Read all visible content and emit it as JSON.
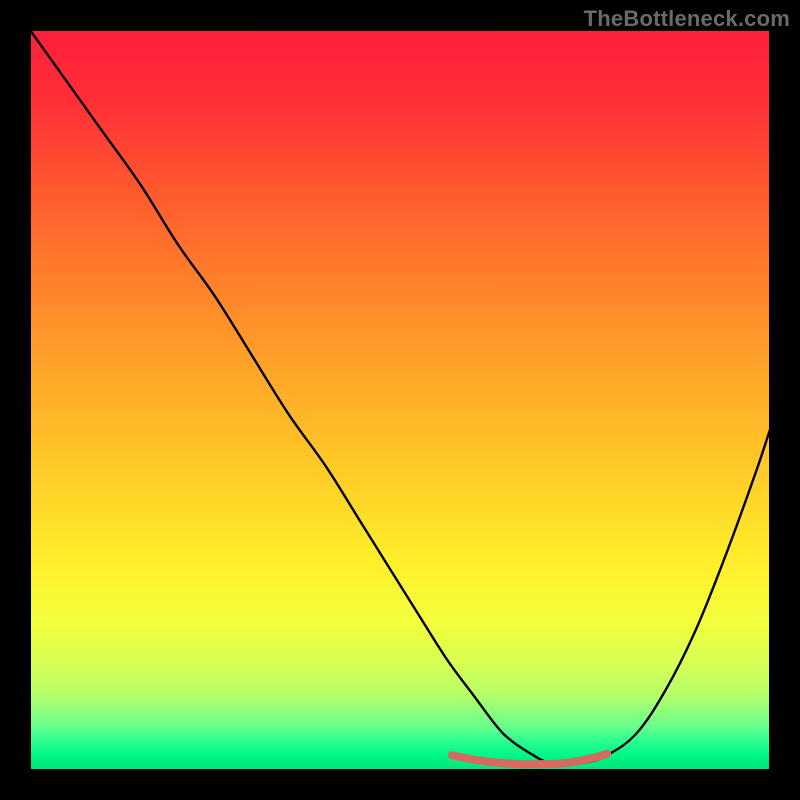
{
  "watermark": {
    "text": "TheBottleneck.com"
  },
  "colors": {
    "black": "#000000",
    "curve_stroke": "#000000",
    "marker_stroke": "#d76a5f",
    "gradient_stops": [
      {
        "offset": 0.0,
        "color": "#ff1f3a"
      },
      {
        "offset": 0.1,
        "color": "#ff3037"
      },
      {
        "offset": 0.22,
        "color": "#ff5a2e"
      },
      {
        "offset": 0.4,
        "color": "#ff932a"
      },
      {
        "offset": 0.58,
        "color": "#ffc727"
      },
      {
        "offset": 0.72,
        "color": "#ffef2a"
      },
      {
        "offset": 0.8,
        "color": "#f3ff3d"
      },
      {
        "offset": 0.86,
        "color": "#d5ff55"
      },
      {
        "offset": 0.9,
        "color": "#b3ff6a"
      },
      {
        "offset": 0.92,
        "color": "#8fff7c"
      },
      {
        "offset": 0.94,
        "color": "#6bff8a"
      },
      {
        "offset": 0.96,
        "color": "#2eff92"
      },
      {
        "offset": 0.98,
        "color": "#00f786"
      },
      {
        "offset": 1.0,
        "color": "#00e37b"
      }
    ]
  },
  "chart_data": {
    "type": "line",
    "title": "",
    "xlabel": "",
    "ylabel": "",
    "xlim": [
      0,
      100
    ],
    "ylim": [
      0,
      100
    ],
    "grid": false,
    "legend": false,
    "series": [
      {
        "name": "bottleneck-curve",
        "x": [
          0,
          5,
          10,
          15,
          20,
          25,
          30,
          35,
          40,
          45,
          50,
          55,
          57,
          60,
          63,
          65,
          68,
          70,
          72,
          75,
          78,
          82,
          86,
          90,
          94,
          98,
          100
        ],
        "y": [
          100,
          93,
          86,
          79,
          71,
          64,
          56,
          48,
          41,
          33,
          25,
          17,
          14,
          10,
          6,
          4,
          2,
          1,
          1,
          1,
          2,
          5,
          11,
          19,
          29,
          40,
          46
        ]
      },
      {
        "name": "optimal-range-marker",
        "x": [
          57,
          60,
          63,
          66,
          69,
          72,
          74,
          76,
          78
        ],
        "y": [
          2,
          1.4,
          1.0,
          0.8,
          0.8,
          0.9,
          1.2,
          1.6,
          2.2
        ]
      }
    ]
  }
}
